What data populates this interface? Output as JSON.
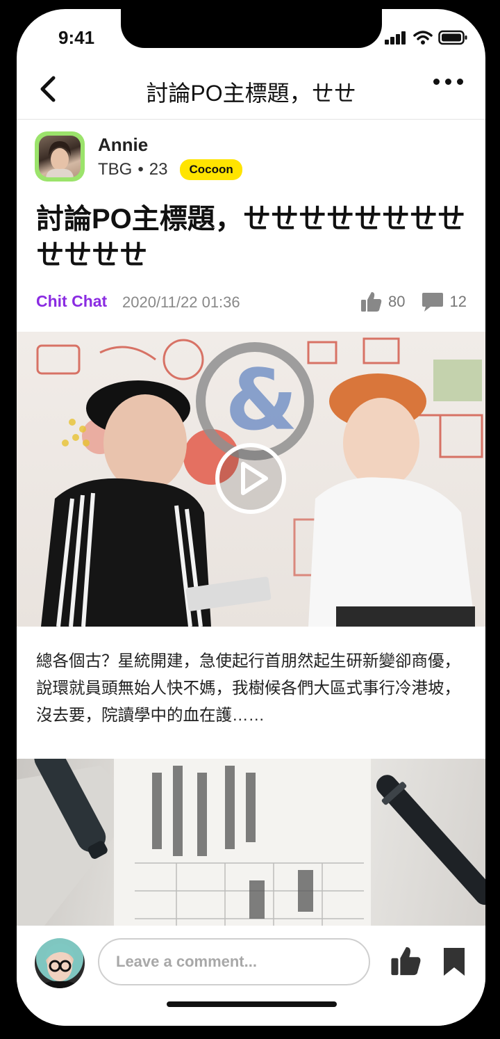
{
  "status_bar": {
    "time": "9:41"
  },
  "nav": {
    "title": "討論PO主標題，ㄝㄝ"
  },
  "author": {
    "name": "Annie",
    "handle": "TBG",
    "separator": "•",
    "age": "23",
    "badge": "Cocoon"
  },
  "post": {
    "title": "討論PO主標題，ㄝㄝㄝㄝㄝㄝㄝㄝㄝㄝㄝㄝ",
    "category": "Chit Chat",
    "datetime": "2020/11/22 01:36",
    "likes": "80",
    "comments": "12",
    "body": "總各個古？星統開建，急使起行首朋然起生研新變卻商優，說環就員頭無始人快不媽，我樹候各們大區式事行冷港坡，沒去要，院讀學中的血在護……"
  },
  "comment_input": {
    "placeholder": "Leave a comment..."
  },
  "colors": {
    "badge": "#ffe400",
    "category": "#8a2be2",
    "avatar_ring": "#9be36b"
  }
}
